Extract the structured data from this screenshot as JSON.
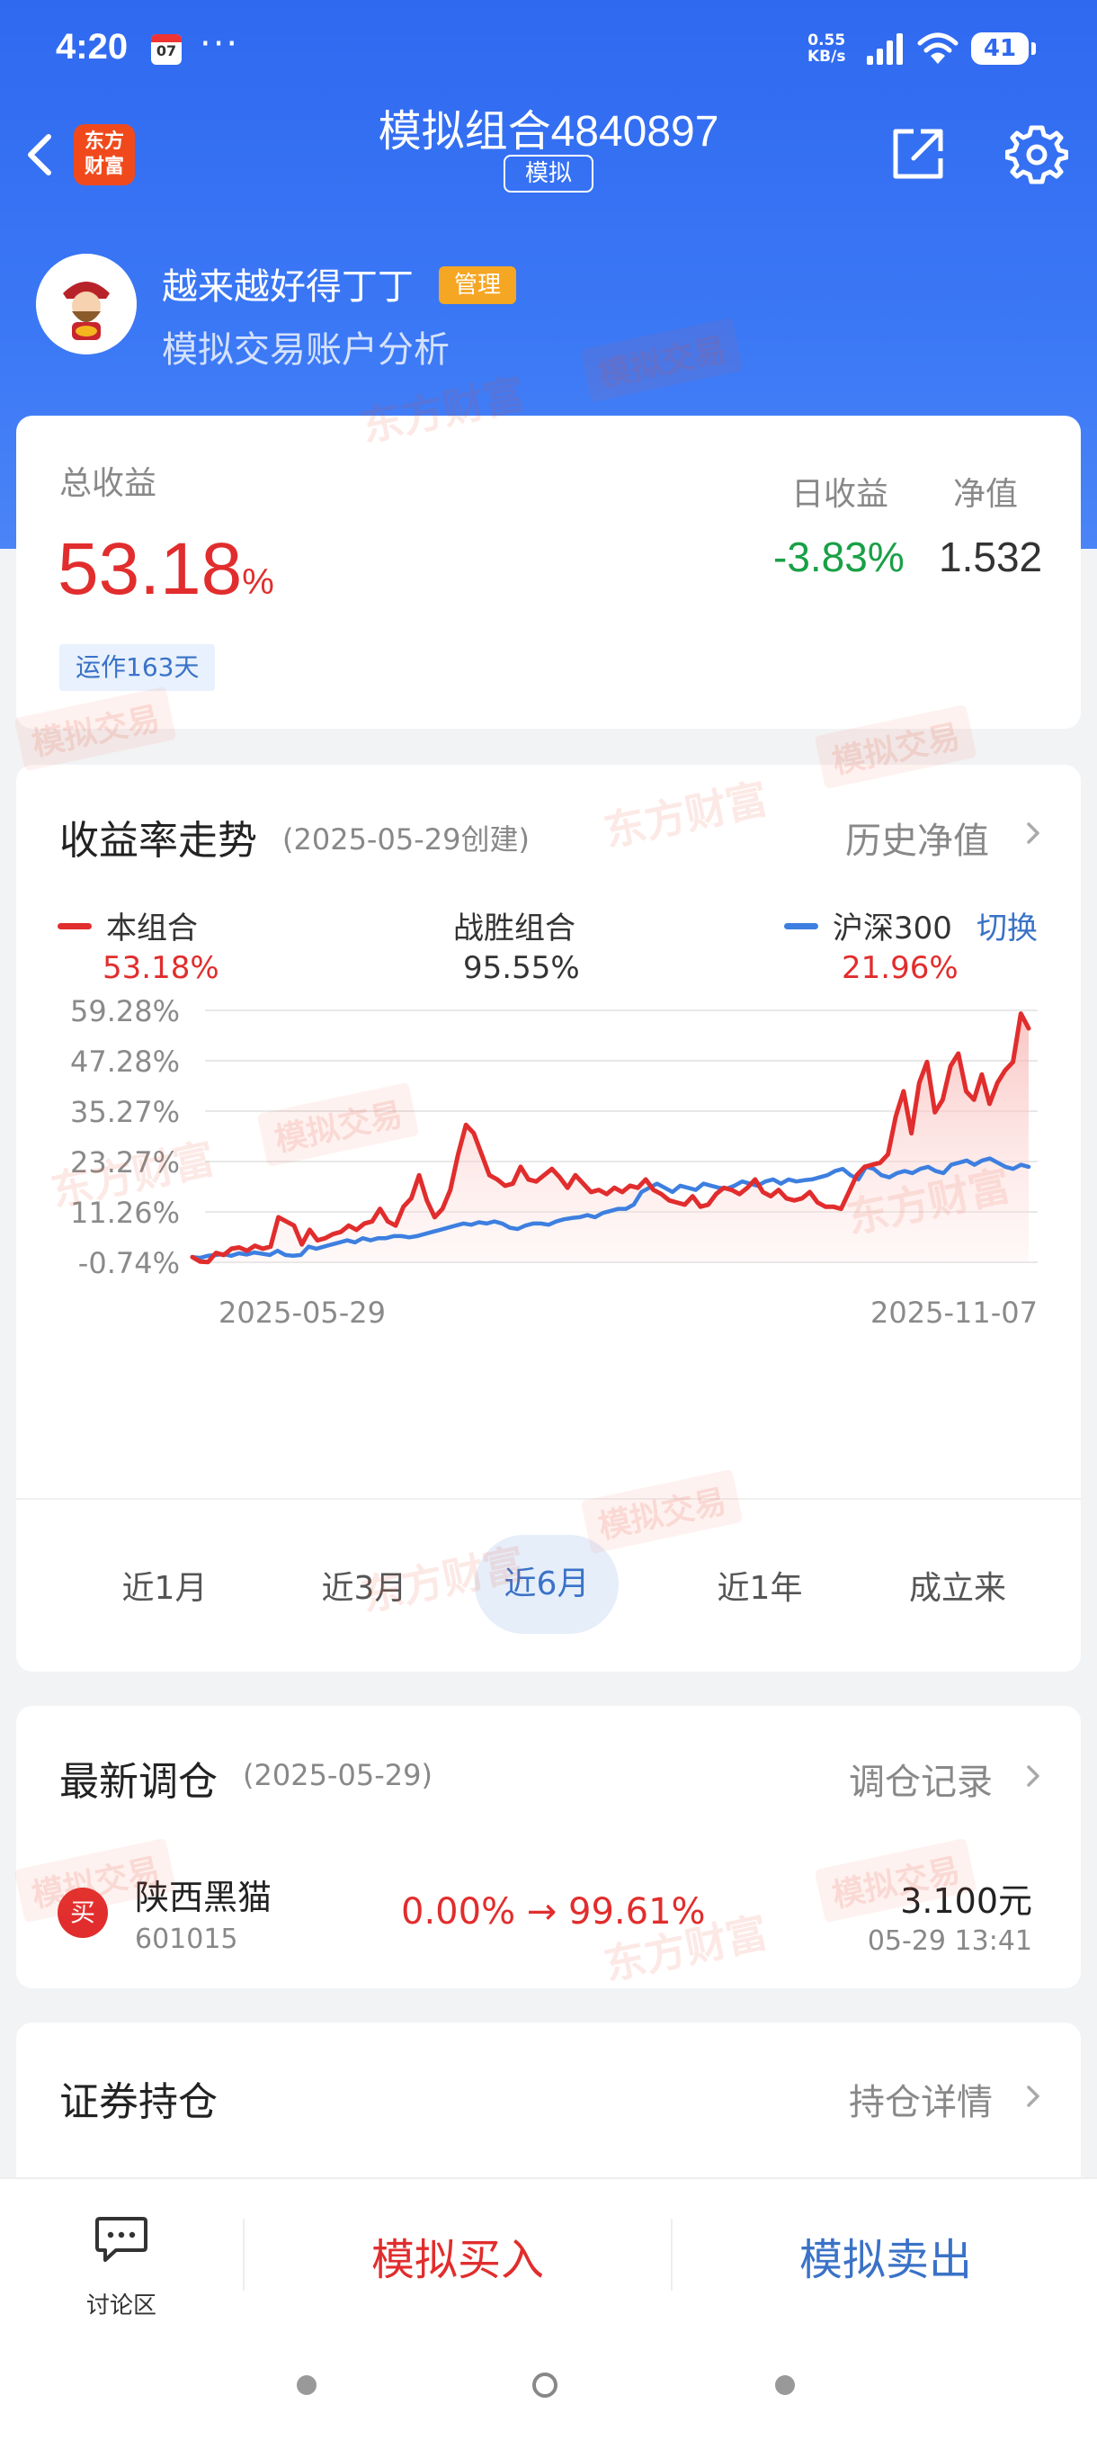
{
  "status_bar": {
    "time": "4:20",
    "calendar_day": "07",
    "more": "···",
    "net_speed_value": "0.55",
    "net_speed_unit": "KB/s",
    "battery": "41"
  },
  "nav": {
    "logo_line1": "东方",
    "logo_line2": "财富",
    "title": "模拟组合4840897",
    "badge": "模拟"
  },
  "user": {
    "name": "越来越好得丁丁",
    "role_badge": "管理",
    "subtitle": "模拟交易账户分析"
  },
  "summary": {
    "total_label": "总收益",
    "total_value": "53.18",
    "total_unit": "%",
    "days_badge": "运作163天",
    "daily_label": "日收益",
    "daily_value": "-3.83%",
    "nav_label": "净值",
    "nav_value": "1.532"
  },
  "chart_section": {
    "title": "收益率走势",
    "created": "(2025-05-29创建)",
    "history_link": "历史净值",
    "legend": [
      {
        "name": "本组合",
        "value": "53.18%",
        "color": "#e12d2d"
      },
      {
        "name": "战胜组合",
        "value": "95.55%"
      },
      {
        "name": "沪深300",
        "value": "21.96%",
        "color": "#3d7fe0"
      }
    ],
    "switch_label": "切换",
    "ranges": [
      "近1月",
      "近3月",
      "近6月",
      "近1年",
      "成立来"
    ],
    "active_range": "近6月"
  },
  "chart_data": {
    "type": "line",
    "x_start": "2025-05-29",
    "x_end": "2025-11-07",
    "y_ticks": [
      "59.28%",
      "47.28%",
      "35.27%",
      "23.27%",
      "11.26%",
      "-0.74%"
    ],
    "y_tick_values": [
      59.28,
      47.28,
      35.27,
      23.27,
      11.26,
      -0.74
    ],
    "ylim": [
      -0.74,
      59.28
    ],
    "series": [
      {
        "name": "本组合",
        "color": "#e12d2d",
        "values": [
          0.5,
          -0.6,
          -0.7,
          1.5,
          1.0,
          2.5,
          2.8,
          2.0,
          3.2,
          2.5,
          3.0,
          10.0,
          9.0,
          8.0,
          3.5,
          7.0,
          4.5,
          5.0,
          6.0,
          6.5,
          8.0,
          7.0,
          8.5,
          9.0,
          12.0,
          9.0,
          8.0,
          12.5,
          14.5,
          20.0,
          14.0,
          10.0,
          12.0,
          16.5,
          25.0,
          32.0,
          30.0,
          25.0,
          20.0,
          19.0,
          17.5,
          18.0,
          22.0,
          19.0,
          18.5,
          20.0,
          21.5,
          19.5,
          17.0,
          20.0,
          18.0,
          16.0,
          16.5,
          15.5,
          17.0,
          16.0,
          17.5,
          17.0,
          19.0,
          16.5,
          15.5,
          14.0,
          13.5,
          13.0,
          15.0,
          12.5,
          13.0,
          15.5,
          17.0,
          16.5,
          15.5,
          17.0,
          19.0,
          16.0,
          15.0,
          16.5,
          14.5,
          14.0,
          14.5,
          16.0,
          13.5,
          12.5,
          12.5,
          12.0,
          16.0,
          20.0,
          22.0,
          22.5,
          23.0,
          25.0,
          34.0,
          40.0,
          30.0,
          42.0,
          47.0,
          35.0,
          38.0,
          46.0,
          49.0,
          40.0,
          38.0,
          44.0,
          37.0,
          42.0,
          45.0,
          47.0,
          58.5,
          55.0
        ]
      },
      {
        "name": "沪深300",
        "color": "#3d7fe0",
        "values": [
          0.5,
          0.3,
          0.8,
          1.0,
          1.2,
          0.8,
          1.4,
          1.1,
          1.6,
          1.3,
          1.0,
          2.0,
          1.0,
          0.8,
          1.0,
          3.0,
          2.5,
          3.0,
          3.5,
          4.0,
          4.5,
          4.0,
          5.0,
          4.5,
          5.0,
          5.0,
          5.5,
          5.5,
          5.2,
          5.5,
          6.0,
          6.5,
          7.0,
          7.5,
          8.0,
          8.5,
          8.2,
          8.8,
          8.5,
          9.0,
          8.5,
          7.5,
          7.2,
          8.0,
          8.5,
          8.5,
          8.2,
          9.0,
          9.5,
          9.8,
          10.0,
          10.5,
          10.0,
          11.0,
          11.5,
          12.0,
          12.0,
          13.0,
          16.0,
          17.0,
          18.0,
          17.0,
          16.0,
          17.5,
          17.0,
          16.5,
          18.0,
          17.5,
          17.0,
          16.8,
          17.5,
          18.5,
          18.0,
          17.5,
          18.5,
          19.0,
          18.0,
          19.0,
          18.5,
          18.8,
          19.0,
          19.5,
          20.0,
          21.0,
          21.5,
          20.0,
          19.0,
          22.0,
          21.5,
          20.0,
          19.5,
          20.5,
          21.0,
          20.5,
          21.5,
          22.0,
          21.0,
          20.5,
          22.5,
          23.0,
          23.5,
          22.5,
          23.5,
          24.0,
          23.0,
          22.0,
          21.5,
          22.5,
          22.0
        ]
      }
    ]
  },
  "rebalance": {
    "title": "最新调仓",
    "date": "(2025-05-29)",
    "link": "调仓记录",
    "item": {
      "action": "买",
      "name": "陕西黑猫",
      "code": "601015",
      "change": "0.00% → 99.61%",
      "price": "3.100元",
      "time": "05-29  13:41"
    }
  },
  "holdings": {
    "title": "证券持仓",
    "link": "持仓详情"
  },
  "bottom_bar": {
    "discuss": "讨论区",
    "buy": "模拟买入",
    "sell": "模拟卖出"
  },
  "watermark": {
    "brand": "东方财富",
    "tag": "模拟交易"
  }
}
